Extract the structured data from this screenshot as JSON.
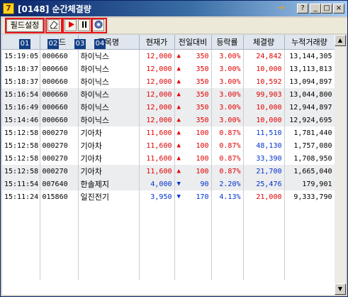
{
  "window": {
    "icon": "7",
    "title": "[0148] 순간체결량",
    "help_label": "?",
    "minimize_glyph": "_",
    "maximize_glyph": "□",
    "close_glyph": "×",
    "pin_glyph": "⊸"
  },
  "toolbar": {
    "field_settings_label": "필드설정",
    "labels": [
      "01",
      "02",
      "03",
      "04"
    ],
    "eraser_icon": "eraser-icon",
    "play_icon": "play-icon",
    "pause_icon": "pause-icon",
    "settings_icon": "gear-icon"
  },
  "table": {
    "headers": [
      "",
      "코드",
      "종목명",
      "현재가",
      "전일대비",
      "등락률",
      "체결량",
      "누적거래량"
    ],
    "rows": [
      {
        "time": "15:19:05",
        "code": "000660",
        "name": "하이닉스",
        "price": "12,000",
        "sign": "▲",
        "change": "350",
        "rate": "3.00%",
        "volume": "24,842",
        "cum": "13,144,305",
        "dir": "up",
        "voldir": "up"
      },
      {
        "time": "15:18:37",
        "code": "000660",
        "name": "하이닉스",
        "price": "12,000",
        "sign": "▲",
        "change": "350",
        "rate": "3.00%",
        "volume": "10,000",
        "cum": "13,113,813",
        "dir": "up",
        "voldir": "up"
      },
      {
        "time": "15:18:37",
        "code": "000660",
        "name": "하이닉스",
        "price": "12,000",
        "sign": "▲",
        "change": "350",
        "rate": "3.00%",
        "volume": "10,592",
        "cum": "13,094,897",
        "dir": "up",
        "voldir": "up"
      },
      {
        "time": "15:16:54",
        "code": "000660",
        "name": "하이닉스",
        "price": "12,000",
        "sign": "▲",
        "change": "350",
        "rate": "3.00%",
        "volume": "99,903",
        "cum": "13,044,800",
        "dir": "up",
        "voldir": "up"
      },
      {
        "time": "15:16:49",
        "code": "000660",
        "name": "하이닉스",
        "price": "12,000",
        "sign": "▲",
        "change": "350",
        "rate": "3.00%",
        "volume": "10,000",
        "cum": "12,944,897",
        "dir": "up",
        "voldir": "up"
      },
      {
        "time": "15:14:46",
        "code": "000660",
        "name": "하이닉스",
        "price": "12,000",
        "sign": "▲",
        "change": "350",
        "rate": "3.00%",
        "volume": "10,000",
        "cum": "12,924,695",
        "dir": "up",
        "voldir": "up"
      },
      {
        "time": "15:12:58",
        "code": "000270",
        "name": "기아차",
        "price": "11,600",
        "sign": "▲",
        "change": "100",
        "rate": "0.87%",
        "volume": "11,510",
        "cum": "1,781,440",
        "dir": "up",
        "voldir": "down"
      },
      {
        "time": "15:12:58",
        "code": "000270",
        "name": "기아차",
        "price": "11,600",
        "sign": "▲",
        "change": "100",
        "rate": "0.87%",
        "volume": "48,130",
        "cum": "1,757,080",
        "dir": "up",
        "voldir": "down"
      },
      {
        "time": "15:12:58",
        "code": "000270",
        "name": "기아차",
        "price": "11,600",
        "sign": "▲",
        "change": "100",
        "rate": "0.87%",
        "volume": "33,390",
        "cum": "1,708,950",
        "dir": "up",
        "voldir": "down"
      },
      {
        "time": "15:12:58",
        "code": "000270",
        "name": "기아차",
        "price": "11,600",
        "sign": "▲",
        "change": "100",
        "rate": "0.87%",
        "volume": "21,700",
        "cum": "1,665,040",
        "dir": "up",
        "voldir": "down"
      },
      {
        "time": "15:11:54",
        "code": "007640",
        "name": "한솔제지",
        "price": "4,000",
        "sign": "▼",
        "change": "90",
        "rate": "2.20%",
        "volume": "25,476",
        "cum": "179,901",
        "dir": "down",
        "voldir": "down"
      },
      {
        "time": "15:11:24",
        "code": "015860",
        "name": "일진전기",
        "price": "3,950",
        "sign": "▼",
        "change": "170",
        "rate": "4.13%",
        "volume": "21,000",
        "cum": "9,333,790",
        "dir": "down",
        "voldir": "up"
      }
    ]
  },
  "colors": {
    "up": "#e00000",
    "down": "#0033cc",
    "highlight_box": "#e8141b",
    "label_bg": "#123f85"
  }
}
